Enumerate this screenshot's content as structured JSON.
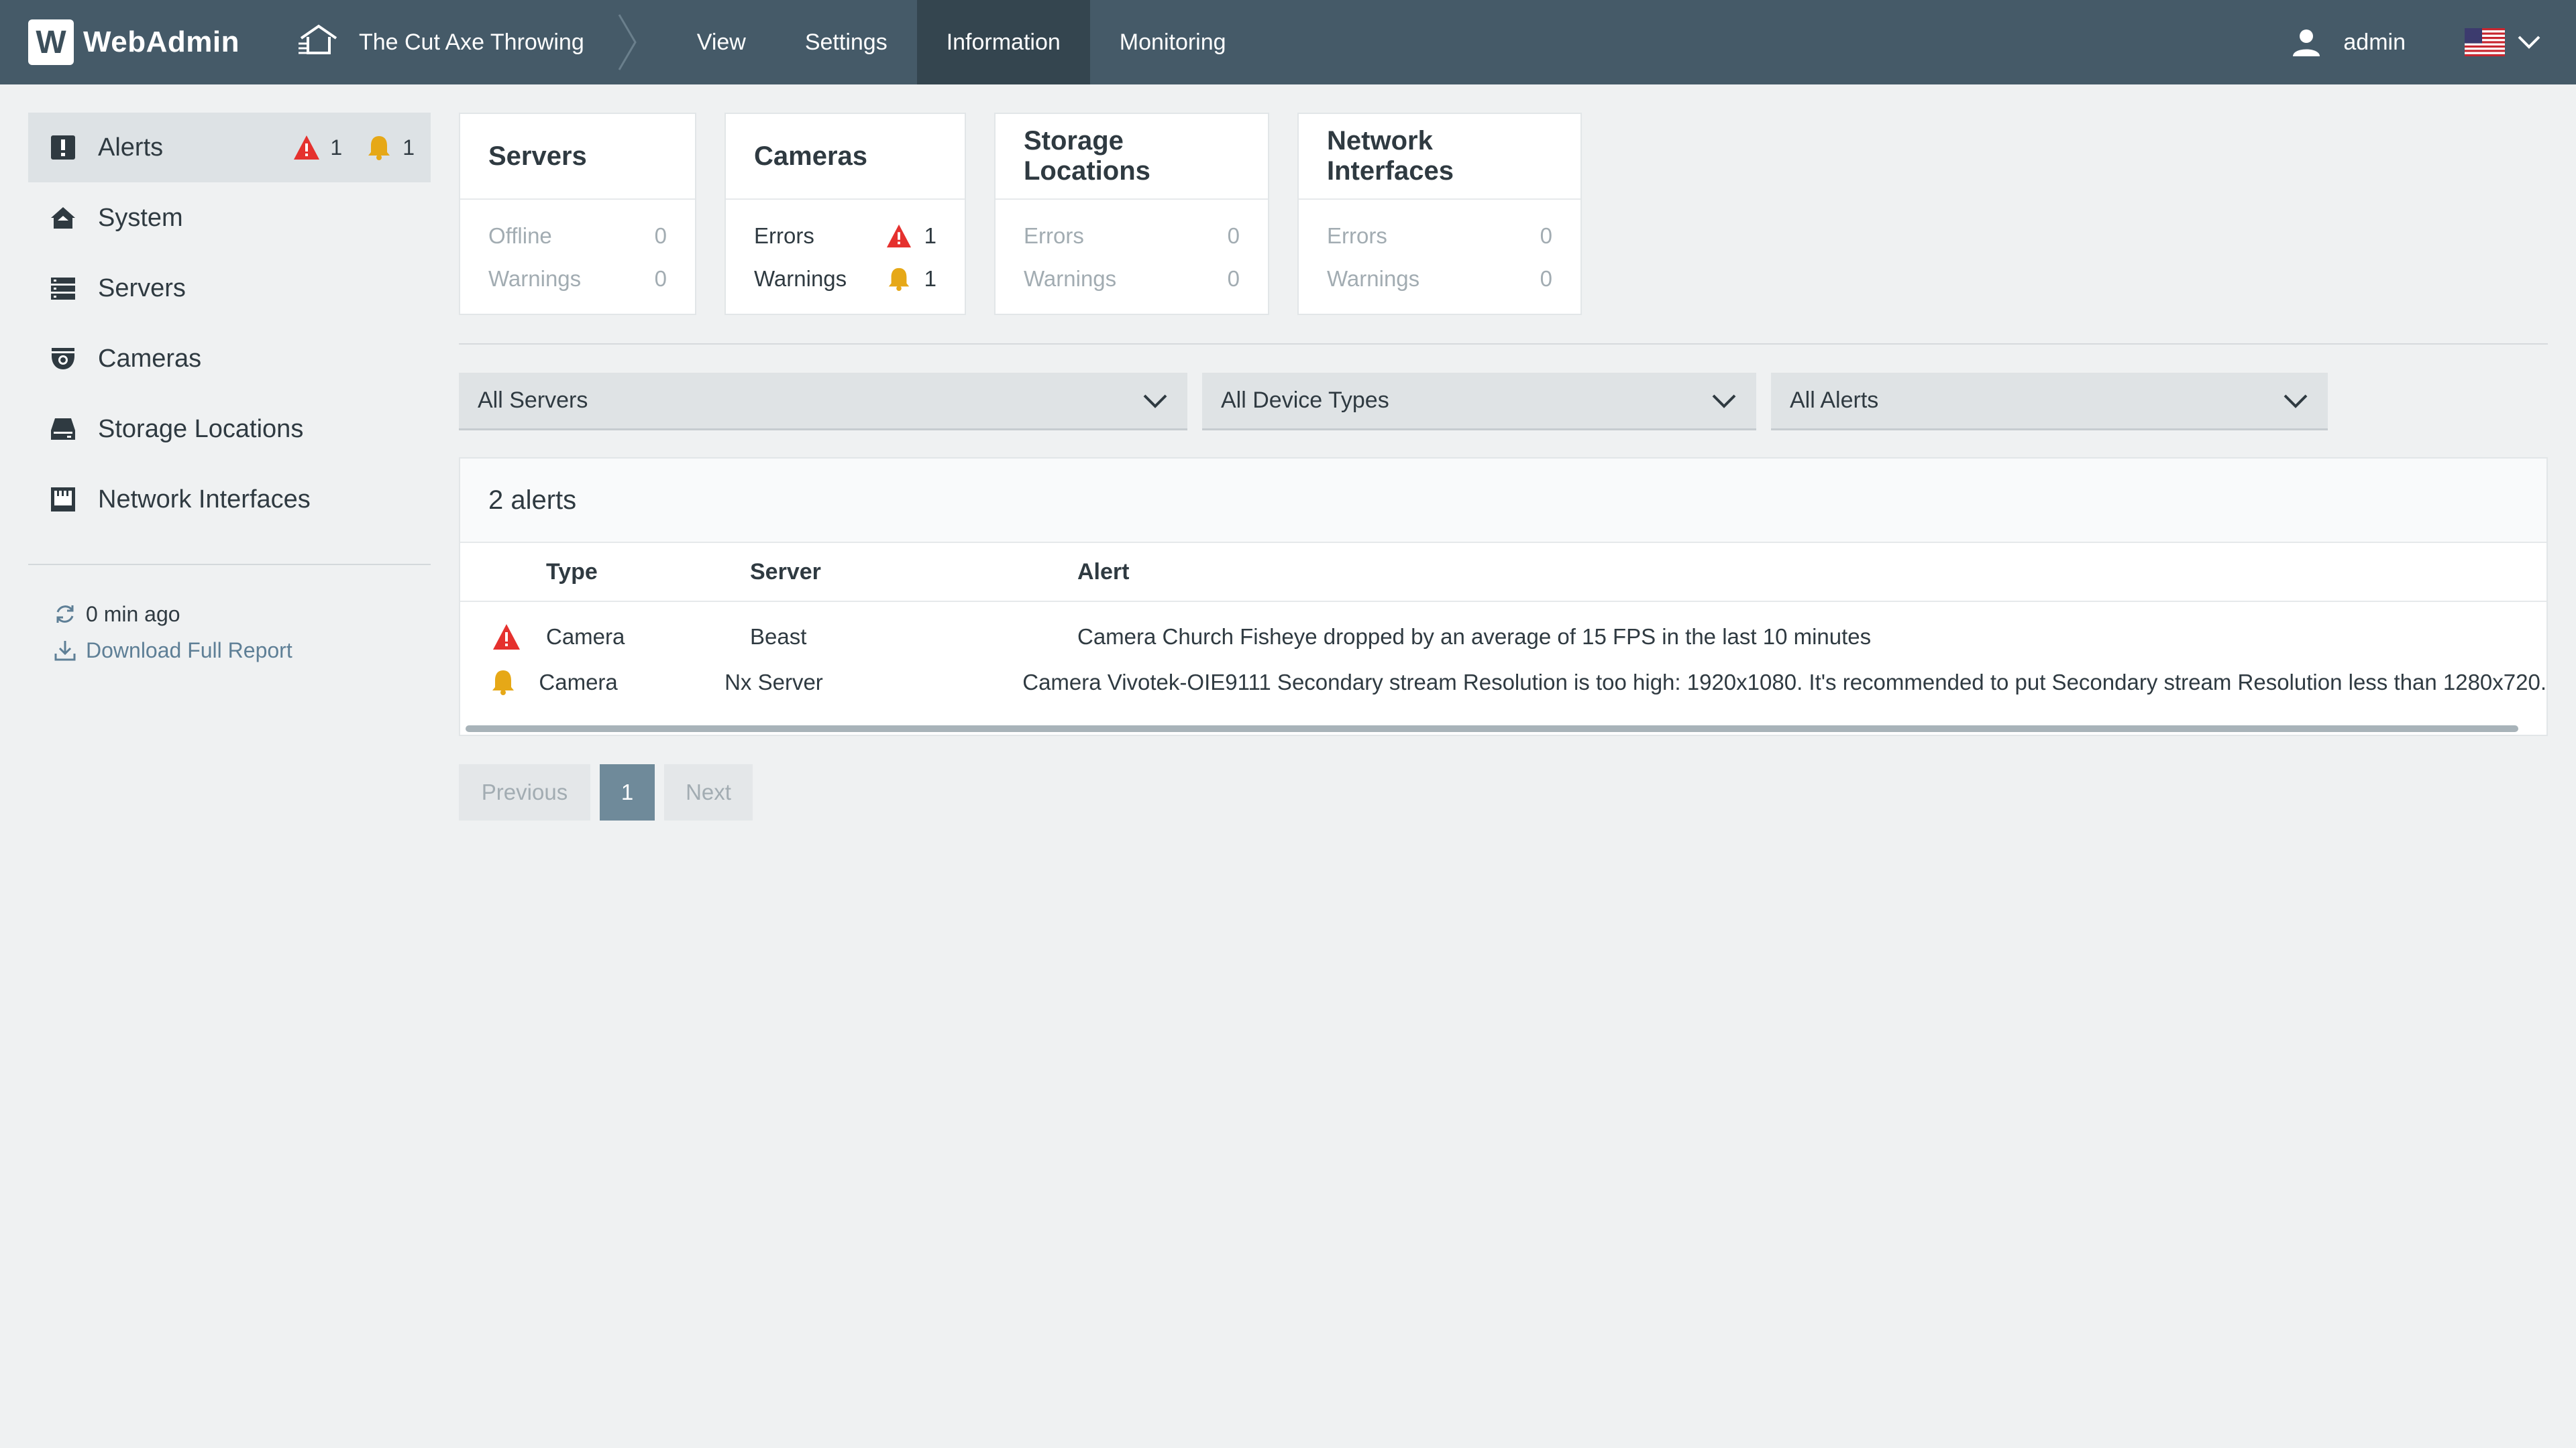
{
  "topbar": {
    "logo_letter": "W",
    "app_name": "WebAdmin",
    "system_name": "The Cut Axe Throwing",
    "nav": [
      {
        "label": "View",
        "active": false
      },
      {
        "label": "Settings",
        "active": false
      },
      {
        "label": "Information",
        "active": true
      },
      {
        "label": "Monitoring",
        "active": false
      }
    ],
    "user": "admin",
    "language_flag": "us-flag-icon"
  },
  "sidebar": {
    "items": [
      {
        "label": "Alerts",
        "icon": "alert-icon",
        "active": true,
        "error_count": "1",
        "warning_count": "1"
      },
      {
        "label": "System",
        "icon": "home-icon",
        "active": false
      },
      {
        "label": "Servers",
        "icon": "server-icon",
        "active": false
      },
      {
        "label": "Cameras",
        "icon": "camera-icon",
        "active": false
      },
      {
        "label": "Storage Locations",
        "icon": "storage-icon",
        "active": false
      },
      {
        "label": "Network Interfaces",
        "icon": "network-icon",
        "active": false
      }
    ],
    "refresh_text": "0 min ago",
    "download_label": "Download Full Report"
  },
  "summary_cards": [
    {
      "title": "Servers",
      "rows": [
        {
          "label": "Offline",
          "value": "0"
        },
        {
          "label": "Warnings",
          "value": "0"
        }
      ]
    },
    {
      "title": "Cameras",
      "rows": [
        {
          "label": "Errors",
          "value": "1",
          "status": "error"
        },
        {
          "label": "Warnings",
          "value": "1",
          "status": "warning"
        }
      ]
    },
    {
      "title": "Storage Locations",
      "rows": [
        {
          "label": "Errors",
          "value": "0"
        },
        {
          "label": "Warnings",
          "value": "0"
        }
      ]
    },
    {
      "title": "Network Interfaces",
      "rows": [
        {
          "label": "Errors",
          "value": "0"
        },
        {
          "label": "Warnings",
          "value": "0"
        }
      ]
    }
  ],
  "filters": {
    "server": "All Servers",
    "device_type": "All Device Types",
    "alert_type": "All Alerts"
  },
  "alerts_table": {
    "count_label": "2 alerts",
    "columns": [
      "Type",
      "Server",
      "Alert"
    ],
    "rows": [
      {
        "severity": "error",
        "type": "Camera",
        "server": "Beast",
        "alert": "Camera Church Fisheye dropped by an average of 15 FPS in the last 10 minutes"
      },
      {
        "severity": "warning",
        "type": "Camera",
        "server": "Nx Server",
        "alert": "Camera Vivotek-OIE9111 Secondary stream Resolution is too high: 1920x1080. It's recommended to put Secondary stream Resolution less than 1280x720."
      }
    ]
  },
  "pagination": {
    "previous_label": "Previous",
    "current_page": "1",
    "next_label": "Next"
  },
  "colors": {
    "topbar": "#455a68",
    "nav_active": "#34454f",
    "error": "#e5312e",
    "warning": "#e6a817",
    "link": "#5e7f96",
    "page_active": "#6f8a9a"
  }
}
